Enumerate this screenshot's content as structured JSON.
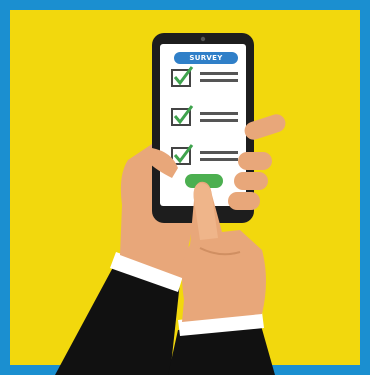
{
  "illustration": {
    "phone_header_text": "SURVEY",
    "checklist_items": [
      {
        "checked": true
      },
      {
        "checked": true
      },
      {
        "checked": true
      }
    ],
    "colors": {
      "border": "#1b8fd0",
      "background": "#f2d80d",
      "header_pill": "#2f7fc8",
      "checkmark": "#3fa34d",
      "submit_button": "#4caf50",
      "skin": "#e8a77a",
      "sleeve": "#111111"
    }
  }
}
